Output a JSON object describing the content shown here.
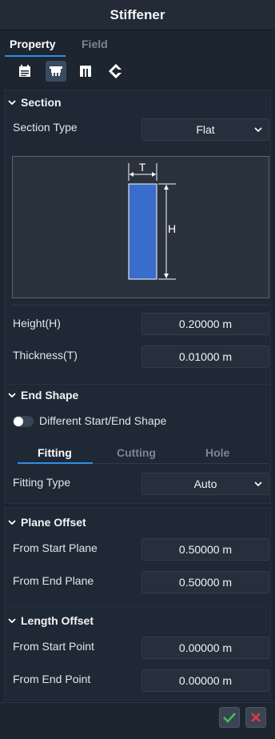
{
  "window": {
    "title": "Stiffener"
  },
  "tabs": [
    {
      "label": "Property"
    },
    {
      "label": "Field"
    }
  ],
  "toolbar": {
    "icons": [
      "calendar-icon",
      "stiffener-profile-icon",
      "bracket-icon",
      "end-connection-icon"
    ],
    "selected_index": 1
  },
  "section": {
    "header": "Section",
    "section_type_label": "Section Type",
    "section_type_value": "Flat",
    "diagram": {
      "thickness_label": "T",
      "height_label": "H",
      "fill_color": "#3a6ccc"
    },
    "height_label": "Height(H)",
    "height_value": "0.20000 m",
    "thickness_label": "Thickness(T)",
    "thickness_value": "0.01000 m"
  },
  "end_shape": {
    "header": "End Shape",
    "toggle_label": "Different Start/End Shape",
    "toggle_on": false,
    "subtabs": [
      {
        "label": "Fitting"
      },
      {
        "label": "Cutting"
      },
      {
        "label": "Hole"
      }
    ],
    "fitting_type_label": "Fitting Type",
    "fitting_type_value": "Auto"
  },
  "plane_offset": {
    "header": "Plane Offset",
    "start_label": "From Start Plane",
    "start_value": "0.50000 m",
    "end_label": "From End Plane",
    "end_value": "0.50000 m"
  },
  "length_offset": {
    "header": "Length Offset",
    "start_label": "From Start Point",
    "start_value": "0.00000 m",
    "end_label": "From End Point",
    "end_value": "0.00000 m"
  },
  "colors": {
    "accent": "#2f8ee8",
    "confirm": "#3cc05a",
    "cancel": "#e03a3a"
  }
}
